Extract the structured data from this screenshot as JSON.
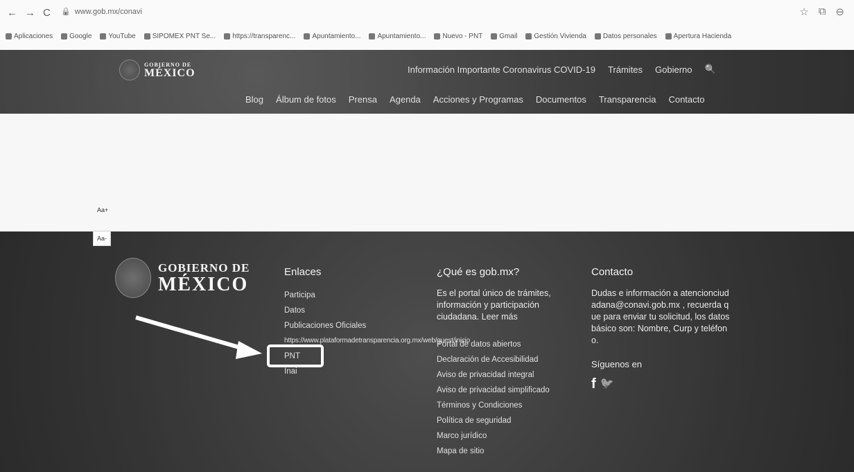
{
  "browser": {
    "back": "←",
    "forward": "→",
    "reload": "C",
    "url": "www.gob.mx/conavi",
    "bookmarks": [
      "Aplicaciones",
      "Google",
      "YouTube",
      "SIPOMEX PNT Se...",
      "https://transparenc...",
      "Apuntamiento...",
      "Apuntamiento...",
      "Nuevo - PNT",
      "Gmail",
      "Gestión Vivienda",
      "Datos personales",
      "Apertura Hacienda"
    ],
    "star_icon": "star-icon",
    "profile_icon": "profile-icon"
  },
  "header": {
    "logo_line1": "GOBIERNO DE",
    "logo_line2": "MÉXICO",
    "top_links": [
      "Información Importante Coronavirus COVID-19",
      "Trámites",
      "Gobierno"
    ],
    "search_icon": "🔍",
    "main_links": [
      "Blog",
      "Álbum de fotos",
      "Prensa",
      "Agenda",
      "Acciones y Programas",
      "Documentos",
      "Transparencia",
      "Contacto"
    ]
  },
  "font_controls": {
    "increase": "Aa+",
    "decrease": "Aa-"
  },
  "footer": {
    "logo_line1": "GOBIERNO DE",
    "logo_line2": "MÉXICO",
    "enlaces": {
      "title": "Enlaces",
      "links": [
        "Participa",
        "Datos",
        "Publicaciones Oficiales",
        "https://www.plataformadetransparencia.org.mx/web/guest/inicio",
        "PNT",
        "Inai"
      ]
    },
    "que_es": {
      "title": "¿Qué es gob.mx?",
      "text": "Es el portal único de trámites, información y participación ciudadana. Leer más",
      "links": [
        "Portal de datos abiertos",
        "Declaración de Accesibilidad",
        "Aviso de privacidad integral",
        "Aviso de privacidad simplificado",
        "Términos y Condiciones",
        "Política de seguridad",
        "Marco jurídico",
        "Mapa de sitio"
      ]
    },
    "contacto": {
      "title": "Contacto",
      "text": "Dudas e información a atencionciudadana@conavi.gob.mx , recuerda que para enviar tu solicitud, los datos básico son: Nombre, Curp y teléfono.",
      "social_title": "Síguenos en",
      "facebook": "f",
      "twitter": "🐦"
    }
  }
}
